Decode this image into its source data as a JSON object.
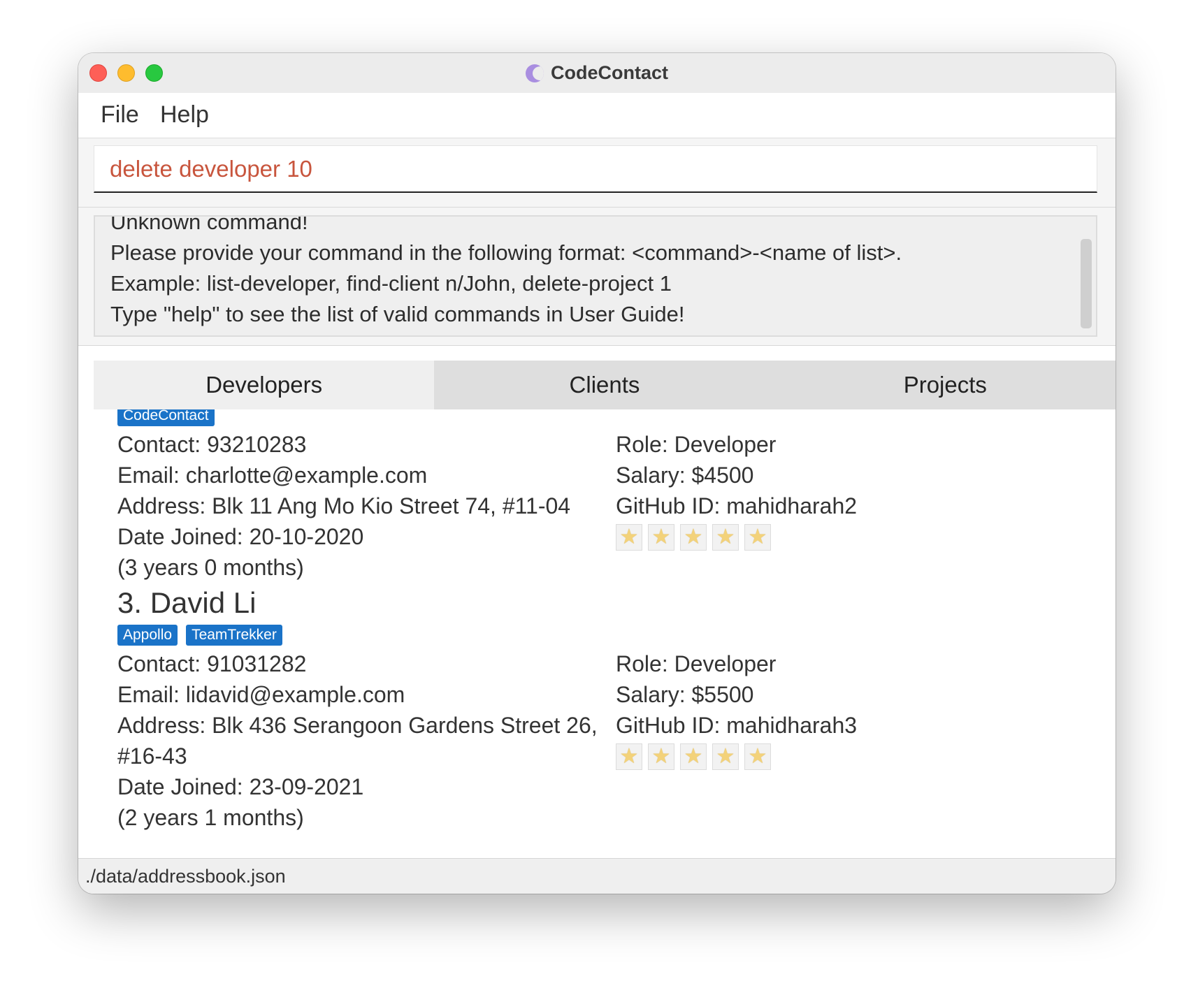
{
  "window": {
    "title": "CodeContact"
  },
  "menu": {
    "items": [
      "File",
      "Help"
    ]
  },
  "command": {
    "value": "delete developer 10"
  },
  "result": {
    "text": "Unknown command!\nPlease provide your command in the following format: <command>-<name of list>.\nExample: list-developer, find-client n/John, delete-project 1\nType \"help\" to see the list of valid commands in User Guide!"
  },
  "tabs": [
    "Developers",
    "Clients",
    "Projects"
  ],
  "active_tab": "Developers",
  "developers": [
    {
      "name": "",
      "tags": [
        "CodeContact"
      ],
      "contact": "Contact: 93210283",
      "email": "Email: charlotte@example.com",
      "address": "Address: Blk 11 Ang Mo Kio Street 74, #11-04",
      "date_joined": "Date Joined: 20-10-2020",
      "duration": "(3 years 0 months)",
      "role": "Role: Developer",
      "salary": "Salary: $4500",
      "github": "GitHub ID: mahidharah2",
      "rating": 5
    },
    {
      "name": "3.  David Li",
      "tags": [
        "Appollo",
        "TeamTrekker"
      ],
      "contact": "Contact: 91031282",
      "email": "Email: lidavid@example.com",
      "address": "Address: Blk 436 Serangoon Gardens Street 26,",
      "address_cont": "#16-43",
      "date_joined": "Date Joined: 23-09-2021",
      "duration": "(2 years 1 months)",
      "role": "Role: Developer",
      "salary": "Salary: $5500",
      "github": "GitHub ID: mahidharah3",
      "rating": 5
    }
  ],
  "status": {
    "file_path": "./data/addressbook.json"
  },
  "colors": {
    "command_text": "#c8553d",
    "tag_bg": "#1a73c8",
    "close": "#fe5f57",
    "minimize": "#febc2e",
    "maximize": "#28c840"
  },
  "icons": {
    "app": "codecontact-logo-icon",
    "rating": "star-icon"
  }
}
